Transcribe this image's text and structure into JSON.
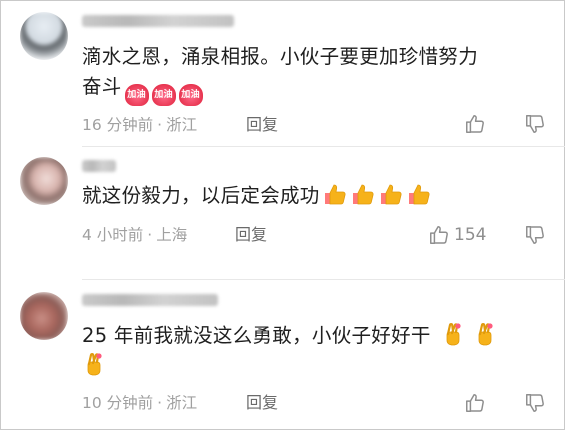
{
  "comments": [
    {
      "text_line1": "滴水之恩，涌泉相报。小伙子要更加珍惜努力",
      "text_line2": "奋斗",
      "sticker_label": "加油",
      "time": "16 分钟前",
      "location": "浙江",
      "reply_label": "回复",
      "like_count": ""
    },
    {
      "text": "就这份毅力，以后定会成功",
      "time": "4 小时前",
      "location": "上海",
      "reply_label": "回复",
      "like_count": "154"
    },
    {
      "text": "25 年前我就没这么勇敢，小伙子好好干",
      "time": "10 分钟前",
      "location": "浙江",
      "reply_label": "回复",
      "like_count": ""
    }
  ],
  "meta_separator": "·",
  "colors": {
    "text": "#1f1f1f",
    "meta": "#a0a0a0",
    "reply": "#6a6a6a",
    "sticker": "#e7344f",
    "thumb_emoji": "#f6b21a"
  },
  "icons": [
    "thumbs-up-icon",
    "thumbs-down-icon",
    "jiayou-heart-sticker",
    "thumbs-up-emoji",
    "crossed-fingers-emoji"
  ]
}
